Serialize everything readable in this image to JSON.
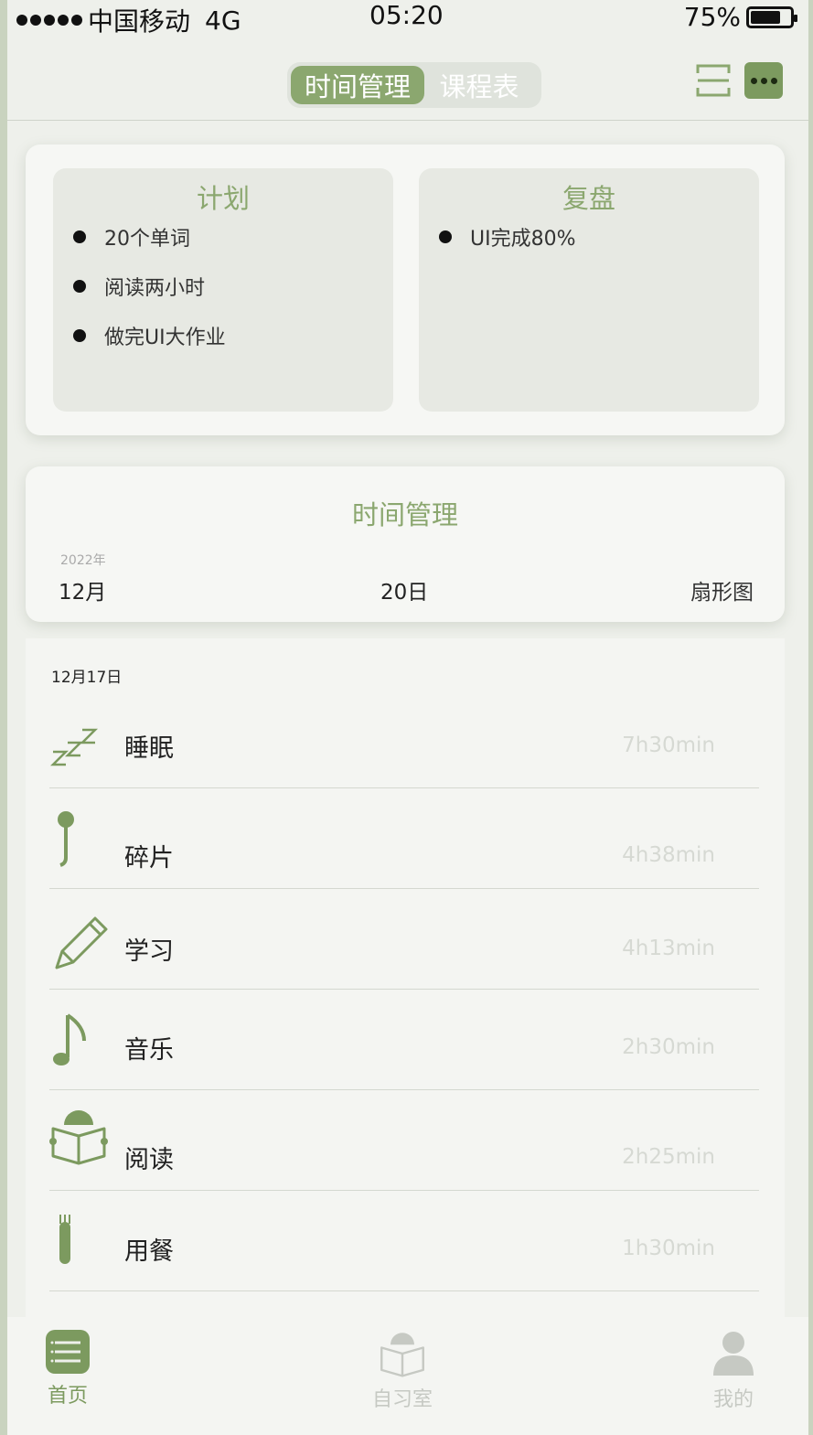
{
  "status_bar": {
    "carrier": "中国移动",
    "network": "4G",
    "time": "05:20",
    "battery_text": "75%",
    "battery_level": 0.75
  },
  "header": {
    "tabs": [
      {
        "label": "时间管理",
        "active": true
      },
      {
        "label": "课程表",
        "active": false
      }
    ],
    "scan_icon": "scan-icon",
    "more_icon": "more-icon"
  },
  "plan_card": {
    "plan": {
      "title": "计划",
      "items": [
        "20个单词",
        "阅读两小时",
        "做完UI大作业"
      ]
    },
    "review": {
      "title": "复盘",
      "items": [
        "UI完成80%"
      ]
    }
  },
  "time_card": {
    "title": "时间管理",
    "year": "2022年",
    "month": "12月",
    "day": "20日",
    "chart_type": "扇形图"
  },
  "list": {
    "date": "12月17日",
    "items": [
      {
        "icon": "sleep-icon",
        "label": "睡眠",
        "duration": "7h30min"
      },
      {
        "icon": "fragment-icon",
        "label": "碎片",
        "duration": "4h38min"
      },
      {
        "icon": "pencil-icon",
        "label": "学习",
        "duration": "4h13min"
      },
      {
        "icon": "music-note-icon",
        "label": "音乐",
        "duration": "2h30min"
      },
      {
        "icon": "reading-icon",
        "label": "阅读",
        "duration": "2h25min"
      },
      {
        "icon": "meal-icon",
        "label": "用餐",
        "duration": "1h30min"
      }
    ]
  },
  "bottom_nav": [
    {
      "icon": "home-icon",
      "label": "首页",
      "active": true
    },
    {
      "icon": "study-room-icon",
      "label": "自习室",
      "active": false
    },
    {
      "icon": "profile-icon",
      "label": "我的",
      "active": false
    }
  ],
  "colors": {
    "accent": "#8ba76f",
    "accent_dark": "#7c9a5f",
    "background": "#eef0eb",
    "card": "#f6f7f4"
  }
}
